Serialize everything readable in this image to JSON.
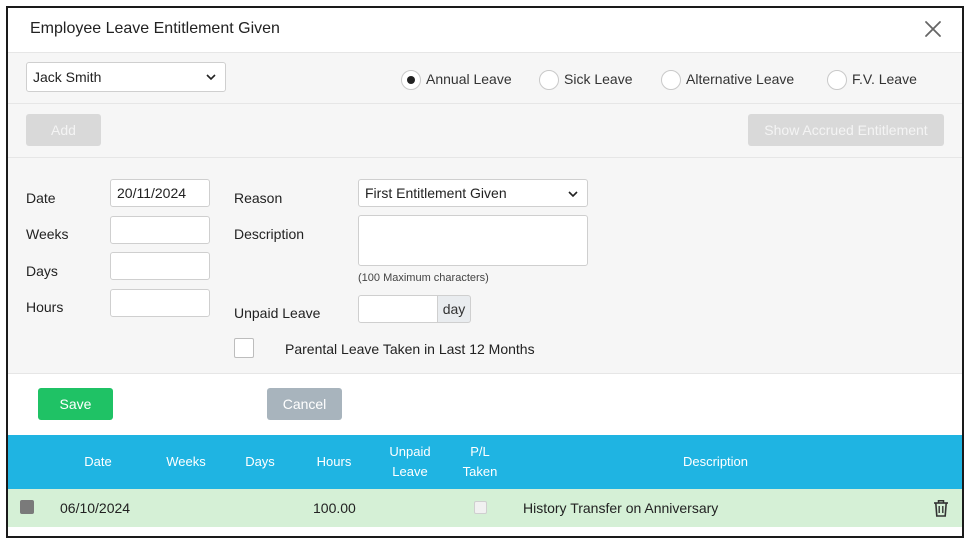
{
  "dialog": {
    "title": "Employee Leave Entitlement Given"
  },
  "employee": {
    "selected": "Jack Smith"
  },
  "leave_types": [
    {
      "label": "Annual Leave",
      "checked": true
    },
    {
      "label": "Sick Leave",
      "checked": false
    },
    {
      "label": "Alternative Leave",
      "checked": false
    },
    {
      "label": "F.V. Leave",
      "checked": false
    }
  ],
  "actions": {
    "add_label": "Add",
    "accrued_label": "Show Accrued Entitlement"
  },
  "form": {
    "date_label": "Date",
    "date_value": "20/11/2024",
    "weeks_label": "Weeks",
    "days_label": "Days",
    "hours_label": "Hours",
    "reason_label": "Reason",
    "reason_value": "First Entitlement Given",
    "description_label": "Description",
    "description_hint": "(100 Maximum characters)",
    "unpaid_label": "Unpaid Leave",
    "unpaid_addon": "day",
    "parental_label": "Parental Leave Taken in Last 12 Months"
  },
  "buttons": {
    "save": "Save",
    "cancel": "Cancel"
  },
  "table": {
    "headers": {
      "date": "Date",
      "weeks": "Weeks",
      "days": "Days",
      "hours": "Hours",
      "unpaid_1": "Unpaid",
      "unpaid_2": "Leave",
      "pl_1": "P/L",
      "pl_2": "Taken",
      "description": "Description"
    },
    "rows": [
      {
        "date": "06/10/2024",
        "weeks": "",
        "days": "",
        "hours": "100.00",
        "unpaid": "",
        "description": "History Transfer on Anniversary"
      }
    ]
  }
}
